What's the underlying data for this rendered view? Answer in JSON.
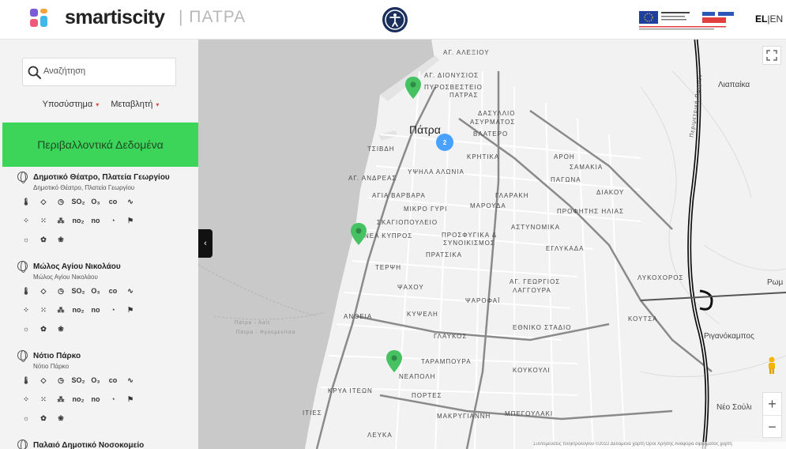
{
  "header": {
    "brand": "smartiscity",
    "city": "| ΠΑΤΡΑ",
    "lang_el": "EL",
    "lang_sep": "|",
    "lang_en": "EN",
    "eu_text": "Ευρωπαϊκή Ένωση",
    "espa_text": "ΕΣΠΑ"
  },
  "sidebar": {
    "search_placeholder": "Αναζήτηση",
    "filter_subsystem": "Υποσύστημα",
    "filter_variable": "Μεταβλητή",
    "category": "Περιβαλλοντικά Δεδομένα",
    "stations": [
      {
        "title": "Δημοτικό Θέατρο, Πλατεία Γεωργίου",
        "subtitle": "Δημοτικό Θέατρο, Πλατεία Γεωργίου"
      },
      {
        "title": "Μώλος Αγίου Νικολάου",
        "subtitle": "Μώλος Αγίου Νικολάου"
      },
      {
        "title": "Νότιο Πάρκο",
        "subtitle": "Νότιο Πάρκο"
      },
      {
        "title": "Παλαιό Δημοτικό Νοσοκομείο",
        "subtitle": ""
      }
    ],
    "sensor_labels": {
      "so2": "SO₂",
      "o3": "O₃",
      "co": "co",
      "no2": "no₂",
      "no": "no"
    }
  },
  "map": {
    "cluster_count": "2",
    "labels": {
      "patra": "Πάτρα",
      "liapaika": "Λιαπαίκα",
      "romanos": "Ρωμ",
      "riganokampos": "Ριγανόκαμπος",
      "neo_souli": "Νέο Σούλι",
      "alexiou": "ΑΓ. ΑΛΕΞΙΟΥ",
      "dionysios": "ΑΓ. ΔΙΟΝΥΣΙΟΣ",
      "pyrosvesteio": "ΠΥΡΟΣΒΕΣΤΕΙΟ",
      "patras": "ΠΑΤΡΑΣ",
      "dasyllio": "ΔΑΣΥΛΛΙΟ",
      "asyrmatos": "ΑΣΥΡΜΑΤΟΣ",
      "vlatero": "ΒΛΑΤΕΡΟ",
      "tsivdi": "ΤΣΙΒΔΗ",
      "kritika": "ΚΡΗΤΙΚΑ",
      "aroi": "ΑΡΟΗ",
      "samakia": "ΣΑΜΑΚΙΑ",
      "ag_andreas": "ΑΓ. ΑΝΔΡΕΑΣ",
      "ypsila_alonia": "ΥΨΗΛΑ ΑΛΩΝΙΑ",
      "pagona": "ΠΑΓΩΝΑ",
      "diakou": "ΔΙΑΚΟΥ",
      "agia_varvara": "ΑΓΙΑ ΒΑΡΒΑΡΑ",
      "glaraki": "ΓΛΑΡΑΚΗ",
      "mikro_gyri": "ΜΙΚΡΟ ΓΥΡΙ",
      "marouda": "ΜΑΡΟΥΔΑ",
      "profitis_ilias": "ΠΡΟΦΗΤΗΣ ΗΛΙΑΣ",
      "skagiopouleio": "ΣΚΑΓΙΟΠΟΥΛΕΙΟ",
      "astynomika": "ΑΣΤΥΝΟΜΙΚΑ",
      "nea_kypros": "ΝΕΑ ΚΥΠΡΟΣ",
      "prosfygika": "ΠΡΟΣΦΥΓΙΚΑ &",
      "synoikismos": "ΣΥΝΟΙΚΙΣΜΟΣ",
      "eglykada": "ΕΓΛΥΚΑΔΑ",
      "pratsika": "ΠΡΑΤΣΙΚΑ",
      "terpsi": "ΤΕΡΨΗ",
      "lykoxoros": "ΛΥΚΟΧΟΡΟΣ",
      "psaxou": "ΨΑΧΟΥ",
      "ag_georgios": "ΑΓ. ΓΕΩΡΓΙΟΣ",
      "laggoura": "ΛΑΓΓΟΥΡΑ",
      "psarofai": "ΨΑΡΟΦΑΪ",
      "antheia": "ΑΝΘΕΙΑ",
      "kyveli": "ΚΥΨΕΛΗ",
      "ethniko_stadio": "ΕΘΝΙΚΟ ΣΤΑΔΙΟ",
      "koutsa": "ΚΟΥΤΣΑ",
      "glafkos": "ΓΛΑΥΚΟΣ",
      "taramboura": "ΤΑΡΑΜΠΟΥΡΑ",
      "koukouli": "ΚΟΥΚΟΥΛΙ",
      "neapoli": "ΝΕΑΠΟΛΗ",
      "krya_iteon": "ΚΡΥΑ ΙΤΕΩΝ",
      "portes": "ΠΟΡΤΕΣ",
      "ities": "ΙΤΙΕΣ",
      "makrygianni": "ΜΑΚΡΥΓΙΑΝΝΗ",
      "bregoulaki": "ΜΠΕΓΟΥΛΑΚΙ",
      "lefka": "ΛΕΥΚΑ",
      "perimetriki": "Περιμετρική Πατρών",
      "patra_lair": "Πάτρα - Λαϊτ",
      "patra_igoumenitsa": "Πάτρα - Ηγουμενίτσα"
    },
    "attribution": "Συντομεύσεις πληκτρολογίου   ©2022 Δεδομένα χάρτη   Όροι Χρήσης   Αναφορά σφάλματος χάρτη",
    "zoom_in": "+",
    "zoom_out": "−",
    "collapse_arrow": "‹"
  },
  "colors": {
    "accent_green": "#3dd45a",
    "cluster_blue": "#4aa1ff",
    "pin_green": "#47c263",
    "a11y_blue": "#1a2f5c"
  }
}
